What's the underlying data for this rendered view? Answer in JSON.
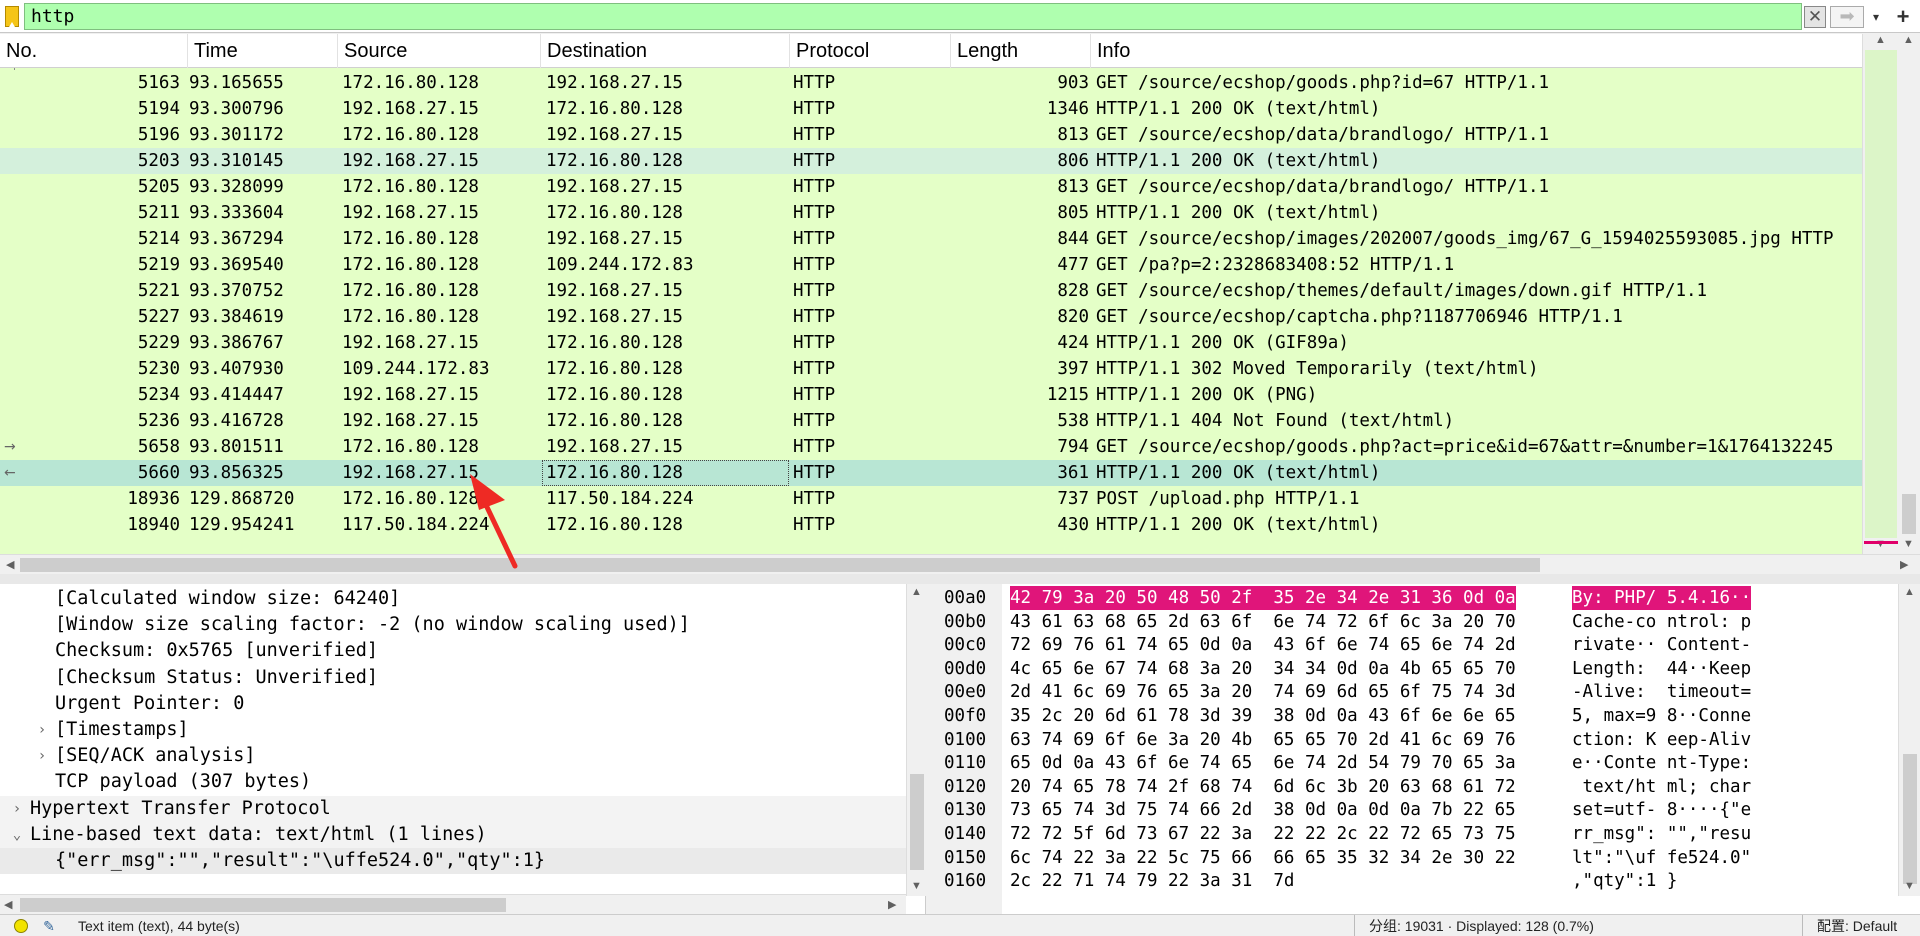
{
  "filter": {
    "value": "http",
    "clear_glyph": "✕",
    "apply_glyph": "➡",
    "dropdown_glyph": "▾",
    "add_glyph": "+"
  },
  "packet_list": {
    "columns": [
      "No.",
      "Time",
      "Source",
      "Destination",
      "Protocol",
      "Length",
      "Info"
    ],
    "rows": [
      {
        "no": "5163",
        "time": "93.165655",
        "src": "172.16.80.128",
        "dst": "192.168.27.15",
        "proto": "HTTP",
        "len": "903",
        "info": "GET /source/ecshop/goods.php?id=67 HTTP/1.1"
      },
      {
        "no": "5194",
        "time": "93.300796",
        "src": "192.168.27.15",
        "dst": "172.16.80.128",
        "proto": "HTTP",
        "len": "1346",
        "info": "HTTP/1.1 200 OK  (text/html)"
      },
      {
        "no": "5196",
        "time": "93.301172",
        "src": "172.16.80.128",
        "dst": "192.168.27.15",
        "proto": "HTTP",
        "len": "813",
        "info": "GET /source/ecshop/data/brandlogo/ HTTP/1.1"
      },
      {
        "no": "5203",
        "time": "93.310145",
        "src": "192.168.27.15",
        "dst": "172.16.80.128",
        "proto": "HTTP",
        "len": "806",
        "info": "HTTP/1.1 200 OK  (text/html)"
      },
      {
        "no": "5205",
        "time": "93.328099",
        "src": "172.16.80.128",
        "dst": "192.168.27.15",
        "proto": "HTTP",
        "len": "813",
        "info": "GET /source/ecshop/data/brandlogo/ HTTP/1.1"
      },
      {
        "no": "5211",
        "time": "93.333604",
        "src": "192.168.27.15",
        "dst": "172.16.80.128",
        "proto": "HTTP",
        "len": "805",
        "info": "HTTP/1.1 200 OK  (text/html)"
      },
      {
        "no": "5214",
        "time": "93.367294",
        "src": "172.16.80.128",
        "dst": "192.168.27.15",
        "proto": "HTTP",
        "len": "844",
        "info": "GET /source/ecshop/images/202007/goods_img/67_G_1594025593085.jpg HTTP"
      },
      {
        "no": "5219",
        "time": "93.369540",
        "src": "172.16.80.128",
        "dst": "109.244.172.83",
        "proto": "HTTP",
        "len": "477",
        "info": "GET /pa?p=2:2328683408:52 HTTP/1.1"
      },
      {
        "no": "5221",
        "time": "93.370752",
        "src": "172.16.80.128",
        "dst": "192.168.27.15",
        "proto": "HTTP",
        "len": "828",
        "info": "GET /source/ecshop/themes/default/images/down.gif HTTP/1.1"
      },
      {
        "no": "5227",
        "time": "93.384619",
        "src": "172.16.80.128",
        "dst": "192.168.27.15",
        "proto": "HTTP",
        "len": "820",
        "info": "GET /source/ecshop/captcha.php?1187706946 HTTP/1.1"
      },
      {
        "no": "5229",
        "time": "93.386767",
        "src": "192.168.27.15",
        "dst": "172.16.80.128",
        "proto": "HTTP",
        "len": "424",
        "info": "HTTP/1.1 200 OK  (GIF89a)"
      },
      {
        "no": "5230",
        "time": "93.407930",
        "src": "109.244.172.83",
        "dst": "172.16.80.128",
        "proto": "HTTP",
        "len": "397",
        "info": "HTTP/1.1 302 Moved Temporarily  (text/html)"
      },
      {
        "no": "5234",
        "time": "93.414447",
        "src": "192.168.27.15",
        "dst": "172.16.80.128",
        "proto": "HTTP",
        "len": "1215",
        "info": "HTTP/1.1 200 OK  (PNG)"
      },
      {
        "no": "5236",
        "time": "93.416728",
        "src": "192.168.27.15",
        "dst": "172.16.80.128",
        "proto": "HTTP",
        "len": "538",
        "info": "HTTP/1.1 404 Not Found  (text/html)"
      },
      {
        "no": "5658",
        "time": "93.801511",
        "src": "172.16.80.128",
        "dst": "192.168.27.15",
        "proto": "HTTP",
        "len": "794",
        "info": "GET /source/ecshop/goods.php?act=price&id=67&attr=&number=1&1764132245"
      },
      {
        "no": "5660",
        "time": "93.856325",
        "src": "192.168.27.15",
        "dst": "172.16.80.128",
        "proto": "HTTP",
        "len": "361",
        "info": "HTTP/1.1 200 OK  (text/html)"
      },
      {
        "no": "18936",
        "time": "129.868720",
        "src": "172.16.80.128",
        "dst": "117.50.184.224",
        "proto": "HTTP",
        "len": "737",
        "info": "POST /upload.php HTTP/1.1"
      },
      {
        "no": "18940",
        "time": "129.954241",
        "src": "117.50.184.224",
        "dst": "172.16.80.128",
        "proto": "HTTP",
        "len": "430",
        "info": "HTTP/1.1 200 OK  (text/html)"
      }
    ],
    "colors": {
      "http_row": "#e4ffc7",
      "selected_row": "#b8e6d4",
      "alt_row": "#d4f0dc"
    }
  },
  "details": {
    "lines": [
      {
        "indent": 2,
        "expander": "",
        "text": "[Calculated window size: 64240]"
      },
      {
        "indent": 2,
        "expander": "",
        "text": "[Window size scaling factor: -2 (no window scaling used)]"
      },
      {
        "indent": 2,
        "expander": "",
        "text": "Checksum: 0x5765 [unverified]"
      },
      {
        "indent": 2,
        "expander": "",
        "text": "[Checksum Status: Unverified]"
      },
      {
        "indent": 2,
        "expander": "",
        "text": "Urgent Pointer: 0"
      },
      {
        "indent": 2,
        "expander": "›",
        "text": "[Timestamps]"
      },
      {
        "indent": 2,
        "expander": "›",
        "text": "[SEQ/ACK analysis]"
      },
      {
        "indent": 2,
        "expander": "",
        "text": "TCP payload (307 bytes)"
      },
      {
        "indent": 1,
        "expander": "›",
        "text": "Hypertext Transfer Protocol"
      },
      {
        "indent": 1,
        "expander": "⌄",
        "text": "Line-based text data: text/html (1 lines)"
      },
      {
        "indent": 2,
        "expander": "",
        "text": "{\"err_msg\":\"\",\"result\":\"\\uffe524.0\",\"qty\":1}"
      }
    ]
  },
  "bytes": {
    "rows": [
      {
        "offset": "00a0",
        "hex": "42 79 3a 20 50 48 50 2f  35 2e 34 2e 31 36 0d 0a",
        "ascii": "By: PHP/ 5.4.16··",
        "highlight": true
      },
      {
        "offset": "00b0",
        "hex": "43 61 63 68 65 2d 63 6f  6e 74 72 6f 6c 3a 20 70",
        "ascii": "Cache-co ntrol: p",
        "highlight": false
      },
      {
        "offset": "00c0",
        "hex": "72 69 76 61 74 65 0d 0a  43 6f 6e 74 65 6e 74 2d",
        "ascii": "rivate·· Content-",
        "highlight": false
      },
      {
        "offset": "00d0",
        "hex": "4c 65 6e 67 74 68 3a 20  34 34 0d 0a 4b 65 65 70",
        "ascii": "Length:  44··Keep",
        "highlight": false
      },
      {
        "offset": "00e0",
        "hex": "2d 41 6c 69 76 65 3a 20  74 69 6d 65 6f 75 74 3d",
        "ascii": "-Alive:  timeout=",
        "highlight": false
      },
      {
        "offset": "00f0",
        "hex": "35 2c 20 6d 61 78 3d 39  38 0d 0a 43 6f 6e 6e 65",
        "ascii": "5, max=9 8··Conne",
        "highlight": false
      },
      {
        "offset": "0100",
        "hex": "63 74 69 6f 6e 3a 20 4b  65 65 70 2d 41 6c 69 76",
        "ascii": "ction: K eep-Aliv",
        "highlight": false
      },
      {
        "offset": "0110",
        "hex": "65 0d 0a 43 6f 6e 74 65  6e 74 2d 54 79 70 65 3a",
        "ascii": "e··Conte nt-Type:",
        "highlight": false
      },
      {
        "offset": "0120",
        "hex": "20 74 65 78 74 2f 68 74  6d 6c 3b 20 63 68 61 72",
        "ascii": " text/ht ml; char",
        "highlight": false
      },
      {
        "offset": "0130",
        "hex": "73 65 74 3d 75 74 66 2d  38 0d 0a 0d 0a 7b 22 65",
        "ascii": "set=utf- 8····{\"e",
        "highlight": false
      },
      {
        "offset": "0140",
        "hex": "72 72 5f 6d 73 67 22 3a  22 22 2c 22 72 65 73 75",
        "ascii": "rr_msg\": \"\",\"resu",
        "highlight": false
      },
      {
        "offset": "0150",
        "hex": "6c 74 22 3a 22 5c 75 66  66 65 35 32 34 2e 30 22",
        "ascii": "lt\":\"\\uf fe524.0\"",
        "highlight": false
      },
      {
        "offset": "0160",
        "hex": "2c 22 71 74 79 22 3a 31  7d",
        "ascii": ",\"qty\":1 }",
        "highlight": false
      }
    ],
    "highlight_color": "#e0157a"
  },
  "statusbar": {
    "text": "Text item (text), 44 byte(s)",
    "packets": "分组: 19031 · Displayed: 128 (0.7%)",
    "profile": "配置: Default"
  }
}
